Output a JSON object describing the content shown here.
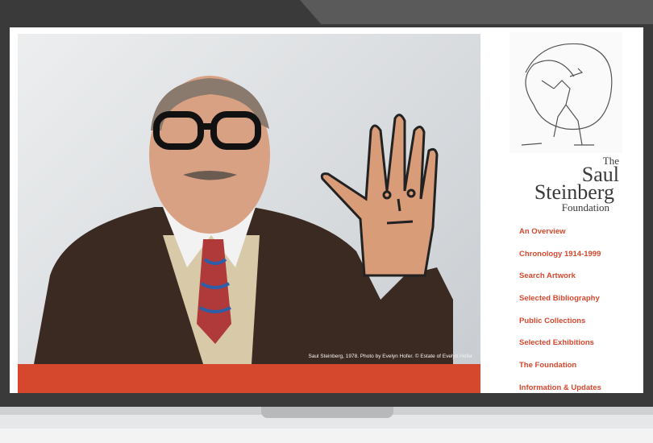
{
  "hero": {
    "caption": "Saul Steinberg, 1978. Photo by Evelyn Hofer. © Estate of Evelyn Hofer"
  },
  "logo": {
    "line1": "The",
    "line2": "Saul",
    "line3": "Steinberg",
    "line4": "Foundation"
  },
  "nav": {
    "items": [
      {
        "label": "An Overview"
      },
      {
        "label": "Chronology 1914-1999"
      },
      {
        "label": "Search Artwork"
      },
      {
        "label": "Selected Bibliography"
      },
      {
        "label": "Public Collections"
      },
      {
        "label": "Selected Exhibitions"
      },
      {
        "label": "The Foundation"
      },
      {
        "label": "Information & Updates"
      }
    ]
  },
  "colors": {
    "accent": "#d5482e",
    "bezel": "#3a3a3a"
  }
}
